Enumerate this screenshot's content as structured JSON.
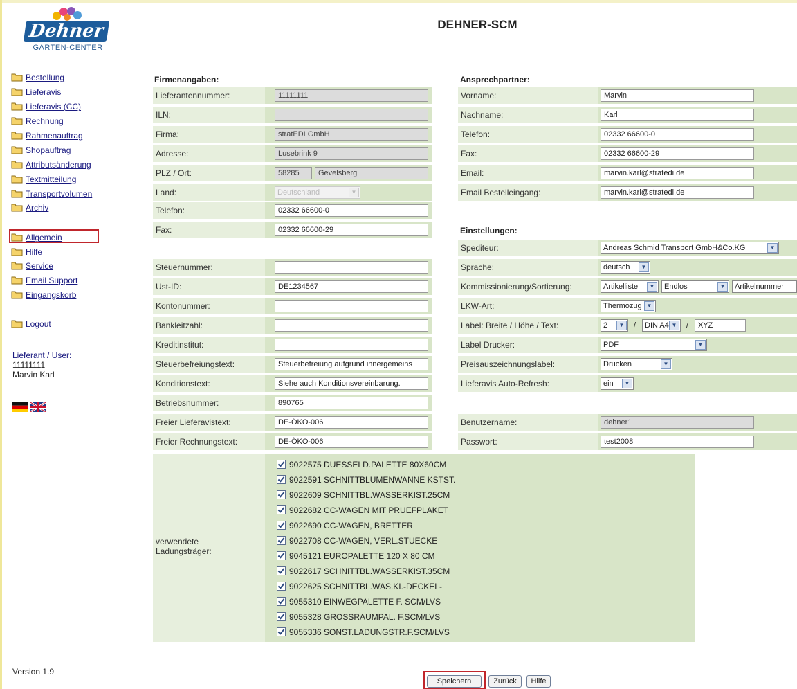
{
  "app_title": "DEHNER-SCM",
  "logo": {
    "brand": "Dehner",
    "subline": "GARTEN-CENTER"
  },
  "nav": {
    "items": [
      "Bestellung",
      "Lieferavis",
      "Lieferavis (CC)",
      "Rechnung",
      "Rahmenauftrag",
      "Shopauftrag",
      "Attributsänderung",
      "Textmitteilung",
      "Transportvolumen",
      "Archiv"
    ],
    "items2": [
      "Allgemein",
      "Hilfe",
      "Service",
      "Email Support",
      "Eingangskorb"
    ],
    "logout": "Logout",
    "active": "Allgemein"
  },
  "user": {
    "label": "Lieferant / User:",
    "id": "11111111",
    "name": "Marvin Karl"
  },
  "version": "Version 1.9",
  "firma": {
    "title": "Firmenangaben:",
    "lieferantennummer": {
      "label": "Lieferantennummer:",
      "value": "11111111"
    },
    "iln": {
      "label": "ILN:",
      "value": ""
    },
    "firma": {
      "label": "Firma:",
      "value": "stratEDI GmbH"
    },
    "adresse": {
      "label": "Adresse:",
      "value": "Lusebrink 9"
    },
    "plz_ort": {
      "label": "PLZ / Ort:",
      "plz": "58285",
      "ort": "Gevelsberg"
    },
    "land": {
      "label": "Land:",
      "value": "Deutschland"
    },
    "telefon": {
      "label": "Telefon:",
      "value": "02332 66600-0"
    },
    "fax": {
      "label": "Fax:",
      "value": "02332 66600-29"
    },
    "steuernummer": {
      "label": "Steuernummer:",
      "value": ""
    },
    "ust_id": {
      "label": "Ust-ID:",
      "value": "DE1234567"
    },
    "kontonummer": {
      "label": "Kontonummer:",
      "value": ""
    },
    "bankleitzahl": {
      "label": "Bankleitzahl:",
      "value": ""
    },
    "kreditinstitut": {
      "label": "Kreditinstitut:",
      "value": ""
    },
    "steuerbefreiungstext": {
      "label": "Steuerbefreiungstext:",
      "value": "Steuerbefreiung aufgrund innergemeins"
    },
    "konditionstext": {
      "label": "Konditionstext:",
      "value": "Siehe auch Konditionsvereinbarung."
    },
    "betriebsnummer": {
      "label": "Betriebsnummer:",
      "value": "890765"
    },
    "freier_lieferavistext": {
      "label": "Freier Lieferavistext:",
      "value": "DE-ÖKO-006"
    },
    "freier_rechnungstext": {
      "label": "Freier Rechnungstext:",
      "value": "DE-ÖKO-006"
    }
  },
  "ansprech": {
    "title": "Ansprechpartner:",
    "vorname": {
      "label": "Vorname:",
      "value": "Marvin"
    },
    "nachname": {
      "label": "Nachname:",
      "value": "Karl"
    },
    "telefon": {
      "label": "Telefon:",
      "value": "02332 66600-0"
    },
    "fax": {
      "label": "Fax:",
      "value": "02332 66600-29"
    },
    "email": {
      "label": "Email:",
      "value": "marvin.karl@stratedi.de"
    },
    "email_bestell": {
      "label": "Email Bestelleingang:",
      "value": "marvin.karl@stratedi.de"
    }
  },
  "einst": {
    "title": "Einstellungen:",
    "spediteur": {
      "label": "Spediteur:",
      "value": "Andreas Schmid Transport GmbH&Co.KG"
    },
    "sprache": {
      "label": "Sprache:",
      "value": "deutsch"
    },
    "kommission": {
      "label": "Kommissionierung/Sortierung:",
      "v1": "Artikelliste",
      "v2": "Endlos",
      "v3": "Artikelnummer"
    },
    "lkw": {
      "label": "LKW-Art:",
      "value": "Thermozug"
    },
    "label_bht": {
      "label": "Label: Breite / Höhe / Text:",
      "breite": "2",
      "hoehe": "DIN A4",
      "text": "XYZ",
      "sep": "/"
    },
    "label_drucker": {
      "label": "Label Drucker:",
      "value": "PDF"
    },
    "preisauszeichnung": {
      "label": "Preisauszeichnungslabel:",
      "value": "Drucken"
    },
    "auto_refresh": {
      "label": "Lieferavis Auto-Refresh:",
      "value": "ein"
    },
    "benutzername": {
      "label": "Benutzername:",
      "value": "dehner1"
    },
    "passwort": {
      "label": "Passwort:",
      "value": "test2008"
    }
  },
  "ladung": {
    "label": "verwendete Ladungsträger:",
    "items": [
      "9022575 DUESSELD.PALETTE 80X60CM",
      "9022591 SCHNITTBLUMENWANNE KSTST.",
      "9022609 SCHNITTBL.WASSERKIST.25CM",
      "9022682 CC-WAGEN MIT PRUEFPLAKET",
      "9022690 CC-WAGEN, BRETTER",
      "9022708 CC-WAGEN, VERL.STUECKE",
      "9045121 EUROPALETTE 120 X 80 CM",
      "9022617 SCHNITTBL.WASSERKIST.35CM",
      "9022625 SCHNITTBL.WAS.KI.-DECKEL-",
      "9055310 EINWEGPALETTE F. SCM/LVS",
      "9055328 GROSSRAUMPAL. F.SCM/LVS",
      "9055336 SONST.LADUNGSTR.F.SCM/LVS"
    ]
  },
  "buttons": {
    "save": "Speichern",
    "back": "Zurück",
    "help": "Hilfe"
  },
  "colors": {
    "label_bg": "#e7efdd",
    "value_bg": "#d8e5c8",
    "highlight": "#c0262c",
    "brand": "#1d5c9b"
  }
}
